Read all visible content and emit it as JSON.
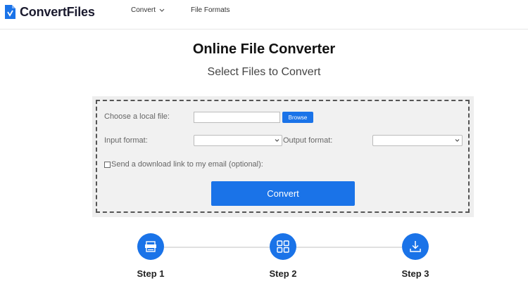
{
  "header": {
    "logo_text": "ConvertFiles",
    "nav": {
      "convert_label": "Convert",
      "file_formats_label": "File Formats"
    }
  },
  "main": {
    "title": "Online File Converter",
    "subtitle": "Select Files to Convert"
  },
  "form": {
    "choose_file_label": "Choose a local file:",
    "file_value": "",
    "browse_label": "Browse",
    "input_format_label": "Input format:",
    "input_format_value": "",
    "output_format_label": "Output format:",
    "output_format_value": "",
    "email_option_label": "Send a download link to my email (optional):",
    "email_option_checked": false,
    "convert_label": "Convert"
  },
  "steps": [
    {
      "label": "Step 1",
      "icon": "file-icon"
    },
    {
      "label": "Step 2",
      "icon": "grid-icon"
    },
    {
      "label": "Step 3",
      "icon": "download-icon"
    }
  ],
  "colors": {
    "accent": "#1a73e8",
    "panel_background": "#eeeeee"
  }
}
